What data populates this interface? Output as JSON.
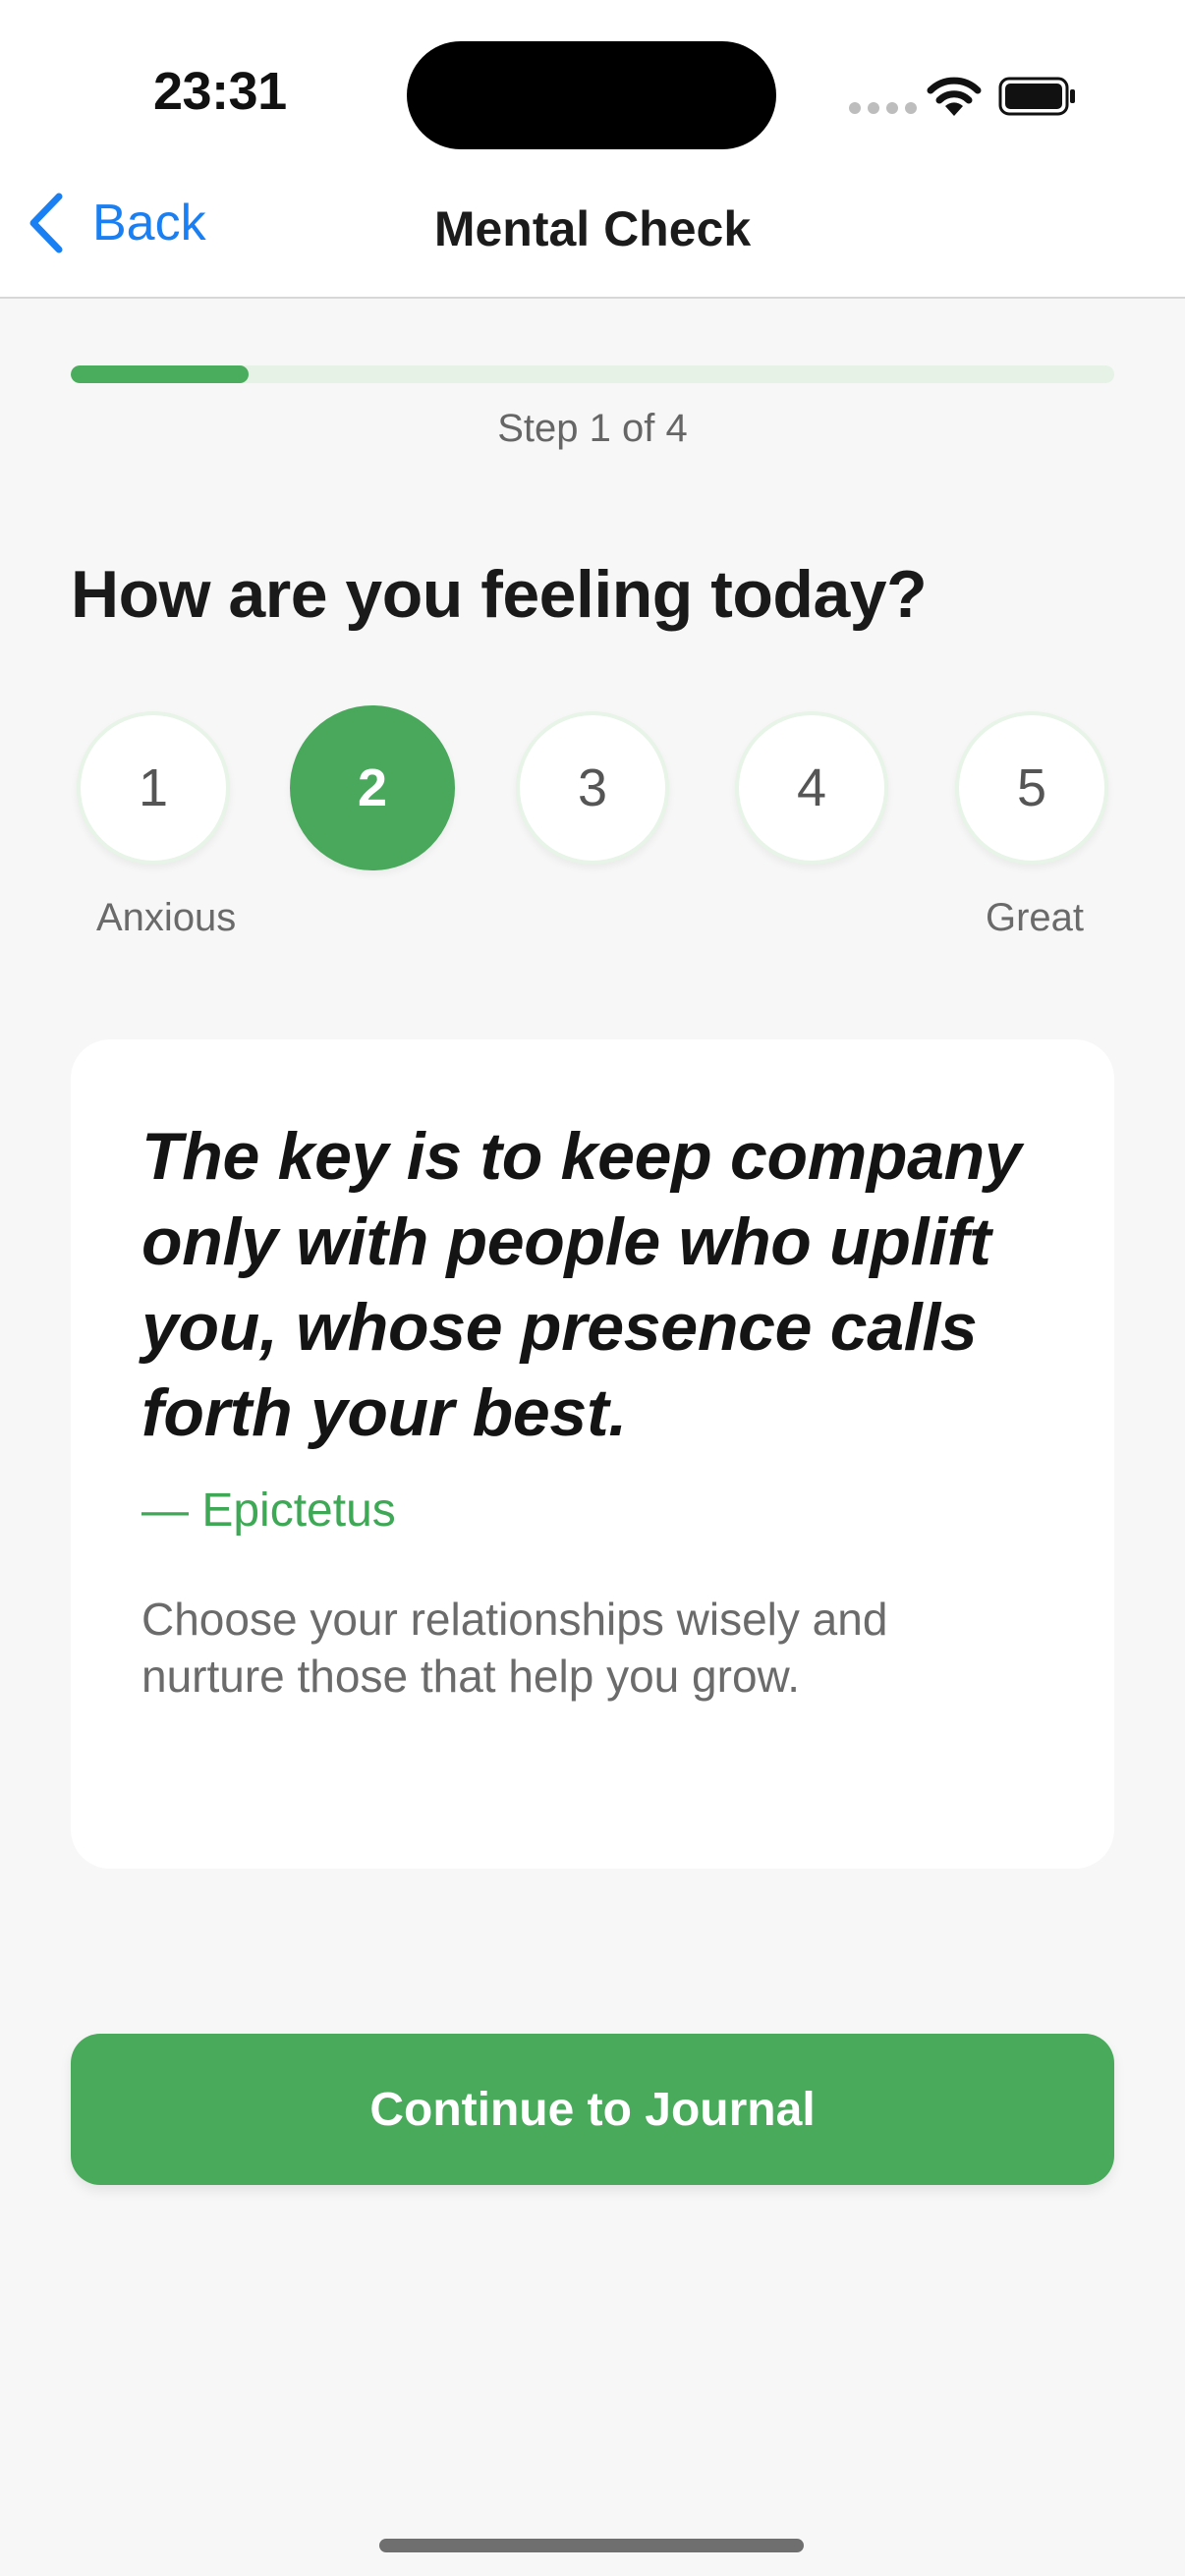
{
  "status_bar": {
    "time": "23:31"
  },
  "nav": {
    "back_label": "Back",
    "title": "Mental Check"
  },
  "progress": {
    "fraction": 0.17,
    "step_text": "Step 1 of 4"
  },
  "question": "How are you feeling today?",
  "rating": {
    "options": [
      "1",
      "2",
      "3",
      "4",
      "5"
    ],
    "selected": "2",
    "low_label": "Anxious",
    "high_label": "Great"
  },
  "quote": {
    "text": "The key is to keep company only with people who uplift you, whose presence calls forth your best.",
    "author": "— Epictetus",
    "note": "Choose your relationships wisely and nurture those that help you grow."
  },
  "cta_label": "Continue to Journal",
  "colors": {
    "accent": "#49aa5b",
    "link": "#1a7ff2"
  },
  "icons": {
    "back": "chevron-left-icon",
    "wifi": "wifi-icon",
    "battery": "battery-icon",
    "signal": "cellular-signal-icon"
  }
}
